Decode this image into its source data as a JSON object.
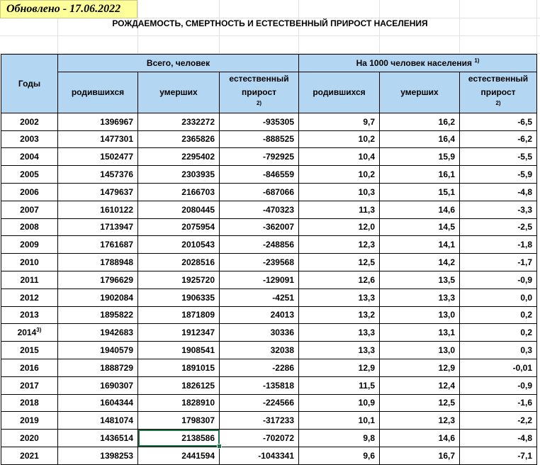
{
  "updated": "Обновлено - 17.06.2022",
  "title": "РОЖДАЕМОСТЬ, СМЕРТНОСТЬ И ЕСТЕСТВЕННЫЙ ПРИРОСТ НАСЕЛЕНИЯ",
  "header": {
    "years": "Годы",
    "total_group": "Всего, человек",
    "per1000_group": "На 1000 человек населения",
    "per1000_note": "1)",
    "born": "родившихся",
    "died": "умерших",
    "natural_line1": "естественный",
    "natural_line2": "прирост",
    "natural_note": "2)"
  },
  "rows": [
    {
      "year": "2002",
      "note": "",
      "born": "1396967",
      "died": "2332272",
      "growth": "-935305",
      "born_r": "9,7",
      "died_r": "16,2",
      "growth_r": "-6,5"
    },
    {
      "year": "2003",
      "note": "",
      "born": "1477301",
      "died": "2365826",
      "growth": "-888525",
      "born_r": "10,2",
      "died_r": "16,4",
      "growth_r": "-6,2"
    },
    {
      "year": "2004",
      "note": "",
      "born": "1502477",
      "died": "2295402",
      "growth": "-792925",
      "born_r": "10,4",
      "died_r": "15,9",
      "growth_r": "-5,5"
    },
    {
      "year": "2005",
      "note": "",
      "born": "1457376",
      "died": "2303935",
      "growth": "-846559",
      "born_r": "10,2",
      "died_r": "16,1",
      "growth_r": "-5,9"
    },
    {
      "year": "2006",
      "note": "",
      "born": "1479637",
      "died": "2166703",
      "growth": "-687066",
      "born_r": "10,3",
      "died_r": "15,1",
      "growth_r": "-4,8"
    },
    {
      "year": "2007",
      "note": "",
      "born": "1610122",
      "died": "2080445",
      "growth": "-470323",
      "born_r": "11,3",
      "died_r": "14,6",
      "growth_r": "-3,3"
    },
    {
      "year": "2008",
      "note": "",
      "born": "1713947",
      "died": "2075954",
      "growth": "-362007",
      "born_r": "12,0",
      "died_r": "14,5",
      "growth_r": "-2,5"
    },
    {
      "year": "2009",
      "note": "",
      "born": "1761687",
      "died": "2010543",
      "growth": "-248856",
      "born_r": "12,3",
      "died_r": "14,1",
      "growth_r": "-1,8"
    },
    {
      "year": "2010",
      "note": "",
      "born": "1788948",
      "died": "2028516",
      "growth": "-239568",
      "born_r": "12,5",
      "died_r": "14,2",
      "growth_r": "-1,7"
    },
    {
      "year": "2011",
      "note": "",
      "born": "1796629",
      "died": "1925720",
      "growth": "-129091",
      "born_r": "12,6",
      "died_r": "13,5",
      "growth_r": "-0,9"
    },
    {
      "year": "2012",
      "note": "",
      "born": "1902084",
      "died": "1906335",
      "growth": "-4251",
      "born_r": "13,3",
      "died_r": "13,3",
      "growth_r": "0,0"
    },
    {
      "year": "2013",
      "note": "",
      "born": "1895822",
      "died": "1871809",
      "growth": "24013",
      "born_r": "13,2",
      "died_r": "13,0",
      "growth_r": "0,2"
    },
    {
      "year": "2014",
      "note": "3)",
      "born": "1942683",
      "died": "1912347",
      "growth": "30336",
      "born_r": "13,3",
      "died_r": "13,1",
      "growth_r": "0,2"
    },
    {
      "year": "2015",
      "note": "",
      "born": "1940579",
      "died": "1908541",
      "growth": "32038",
      "born_r": "13,3",
      "died_r": "13,0",
      "growth_r": "0,3"
    },
    {
      "year": "2016",
      "note": "",
      "born": "1888729",
      "died": "1891015",
      "growth": "-2286",
      "born_r": "12,9",
      "died_r": "12,9",
      "growth_r": "-0,01"
    },
    {
      "year": "2017",
      "note": "",
      "born": "1690307",
      "died": "1826125",
      "growth": "-135818",
      "born_r": "11,5",
      "died_r": "12,4",
      "growth_r": "-0,9"
    },
    {
      "year": "2018",
      "note": "",
      "born": "1604344",
      "died": "1828910",
      "growth": "-224566",
      "born_r": "10,9",
      "died_r": "12,5",
      "growth_r": "-1,6"
    },
    {
      "year": "2019",
      "note": "",
      "born": "1481074",
      "died": "1798307",
      "growth": "-317233",
      "born_r": "10,1",
      "died_r": "12,3",
      "growth_r": "-2,2"
    },
    {
      "year": "2020",
      "note": "",
      "born": "1436514",
      "died": "2138586",
      "growth": "-702072",
      "born_r": "9,8",
      "died_r": "14,6",
      "growth_r": "-4,8"
    },
    {
      "year": "2021",
      "note": "",
      "born": "1398253",
      "died": "2441594",
      "growth": "-1043341",
      "born_r": "9,6",
      "died_r": "16,7",
      "growth_r": "-7,1"
    }
  ]
}
